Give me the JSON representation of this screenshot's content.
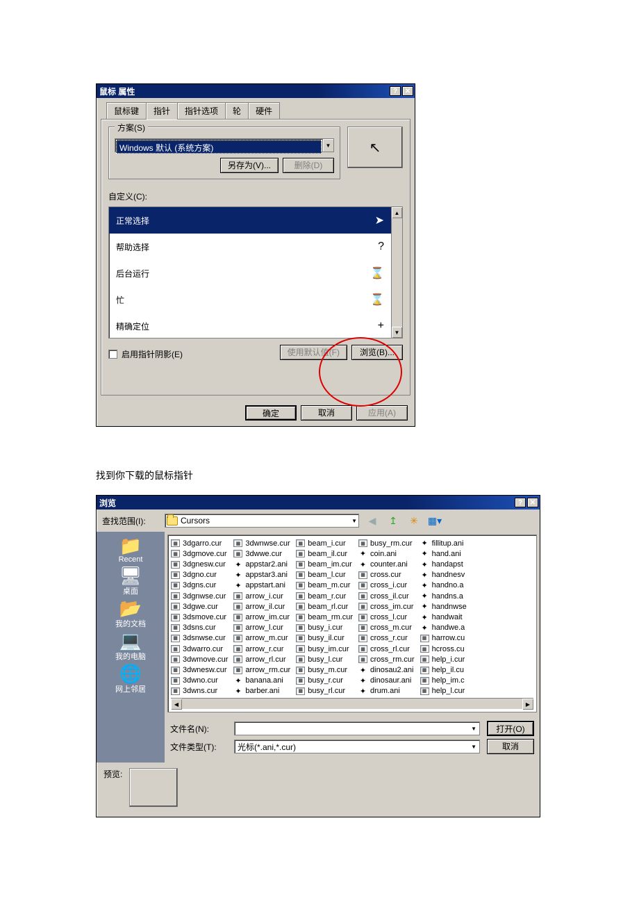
{
  "dialog1": {
    "title": "鼠标 属性",
    "tabs": [
      "鼠标键",
      "指针",
      "指针选项",
      "轮",
      "硬件"
    ],
    "active_tab": 1,
    "scheme_group": "方案(S)",
    "scheme_value": "Windows 默认 (系统方案)",
    "save_as": "另存为(V)...",
    "delete": "删除(D)",
    "custom_label": "自定义(C):",
    "cursor_list": [
      {
        "label": "正常选择",
        "glyph": "➤",
        "selected": true
      },
      {
        "label": "帮助选择",
        "glyph": "?"
      },
      {
        "label": "后台运行",
        "glyph": "⌛"
      },
      {
        "label": "忙",
        "glyph": "⌛"
      },
      {
        "label": "精确定位",
        "glyph": "+"
      }
    ],
    "enable_shadow": "启用指针阴影(E)",
    "use_default": "使用默认值(F)",
    "browse": "浏览(B)...",
    "ok": "确定",
    "cancel": "取消",
    "apply": "应用(A)"
  },
  "instruction": "找到你下载的鼠标指针",
  "dialog2": {
    "title": "浏览",
    "lookin_label": "查找范围(I):",
    "lookin_value": "Cursors",
    "places": [
      {
        "icon": "📁",
        "label": "Recent"
      },
      {
        "icon": "🖥",
        "label": "桌面"
      },
      {
        "icon": "📂",
        "label": "我的文档"
      },
      {
        "icon": "💻",
        "label": "我的电脑"
      },
      {
        "icon": "🌐",
        "label": "网上邻居"
      }
    ],
    "files_col1": [
      {
        "t": "c",
        "n": "3dgarro.cur"
      },
      {
        "t": "c",
        "n": "3dgmove.cur"
      },
      {
        "t": "c",
        "n": "3dgnesw.cur"
      },
      {
        "t": "c",
        "n": "3dgno.cur"
      },
      {
        "t": "c",
        "n": "3dgns.cur"
      },
      {
        "t": "c",
        "n": "3dgnwse.cur"
      },
      {
        "t": "c",
        "n": "3dgwe.cur"
      },
      {
        "t": "c",
        "n": "3dsmove.cur"
      },
      {
        "t": "c",
        "n": "3dsns.cur"
      },
      {
        "t": "c",
        "n": "3dsnwse.cur"
      },
      {
        "t": "c",
        "n": "3dwarro.cur"
      },
      {
        "t": "c",
        "n": "3dwmove.cur"
      },
      {
        "t": "c",
        "n": "3dwnesw.cur"
      },
      {
        "t": "c",
        "n": "3dwno.cur"
      },
      {
        "t": "c",
        "n": "3dwns.cur"
      }
    ],
    "files_col2": [
      {
        "t": "c",
        "n": "3dwnwse.cur"
      },
      {
        "t": "c",
        "n": "3dwwe.cur"
      },
      {
        "t": "a",
        "n": "appstar2.ani"
      },
      {
        "t": "a",
        "n": "appstar3.ani"
      },
      {
        "t": "a",
        "n": "appstart.ani"
      },
      {
        "t": "c",
        "n": "arrow_i.cur"
      },
      {
        "t": "c",
        "n": "arrow_il.cur"
      },
      {
        "t": "c",
        "n": "arrow_im.cur"
      },
      {
        "t": "c",
        "n": "arrow_l.cur"
      },
      {
        "t": "c",
        "n": "arrow_m.cur"
      },
      {
        "t": "c",
        "n": "arrow_r.cur"
      },
      {
        "t": "c",
        "n": "arrow_rl.cur"
      },
      {
        "t": "c",
        "n": "arrow_rm.cur"
      },
      {
        "t": "a",
        "n": "banana.ani"
      },
      {
        "t": "a",
        "n": "barber.ani"
      }
    ],
    "files_col3": [
      {
        "t": "c",
        "n": "beam_i.cur"
      },
      {
        "t": "c",
        "n": "beam_il.cur"
      },
      {
        "t": "c",
        "n": "beam_im.cur"
      },
      {
        "t": "c",
        "n": "beam_l.cur"
      },
      {
        "t": "c",
        "n": "beam_m.cur"
      },
      {
        "t": "c",
        "n": "beam_r.cur"
      },
      {
        "t": "c",
        "n": "beam_rl.cur"
      },
      {
        "t": "c",
        "n": "beam_rm.cur"
      },
      {
        "t": "c",
        "n": "busy_i.cur"
      },
      {
        "t": "c",
        "n": "busy_il.cur"
      },
      {
        "t": "c",
        "n": "busy_im.cur"
      },
      {
        "t": "c",
        "n": "busy_l.cur"
      },
      {
        "t": "c",
        "n": "busy_m.cur"
      },
      {
        "t": "c",
        "n": "busy_r.cur"
      },
      {
        "t": "c",
        "n": "busy_rl.cur"
      }
    ],
    "files_col4": [
      {
        "t": "c",
        "n": "busy_rm.cur"
      },
      {
        "t": "a",
        "n": "coin.ani"
      },
      {
        "t": "a",
        "n": "counter.ani"
      },
      {
        "t": "c",
        "n": "cross.cur"
      },
      {
        "t": "c",
        "n": "cross_i.cur"
      },
      {
        "t": "c",
        "n": "cross_il.cur"
      },
      {
        "t": "c",
        "n": "cross_im.cur"
      },
      {
        "t": "c",
        "n": "cross_l.cur"
      },
      {
        "t": "c",
        "n": "cross_m.cur"
      },
      {
        "t": "c",
        "n": "cross_r.cur"
      },
      {
        "t": "c",
        "n": "cross_rl.cur"
      },
      {
        "t": "c",
        "n": "cross_rm.cur"
      },
      {
        "t": "a",
        "n": "dinosau2.ani"
      },
      {
        "t": "a",
        "n": "dinosaur.ani"
      },
      {
        "t": "a",
        "n": "drum.ani"
      }
    ],
    "files_col5": [
      {
        "t": "a",
        "n": "fillitup.ani"
      },
      {
        "t": "a",
        "n": "hand.ani"
      },
      {
        "t": "a",
        "n": "handapst"
      },
      {
        "t": "a",
        "n": "handnesv"
      },
      {
        "t": "a",
        "n": "handno.a"
      },
      {
        "t": "a",
        "n": "handns.a"
      },
      {
        "t": "a",
        "n": "handnwse"
      },
      {
        "t": "a",
        "n": "handwait"
      },
      {
        "t": "a",
        "n": "handwe.a"
      },
      {
        "t": "c",
        "n": "harrow.cu"
      },
      {
        "t": "c",
        "n": "hcross.cu"
      },
      {
        "t": "c",
        "n": "help_i.cur"
      },
      {
        "t": "c",
        "n": "help_il.cu"
      },
      {
        "t": "c",
        "n": "help_im.c"
      },
      {
        "t": "c",
        "n": "help_l.cur"
      }
    ],
    "filename_label": "文件名(N):",
    "filename_value": "",
    "filetype_label": "文件类型(T):",
    "filetype_value": "光标(*.ani,*.cur)",
    "open": "打开(O)",
    "cancel": "取消",
    "preview_label": "预览:"
  }
}
